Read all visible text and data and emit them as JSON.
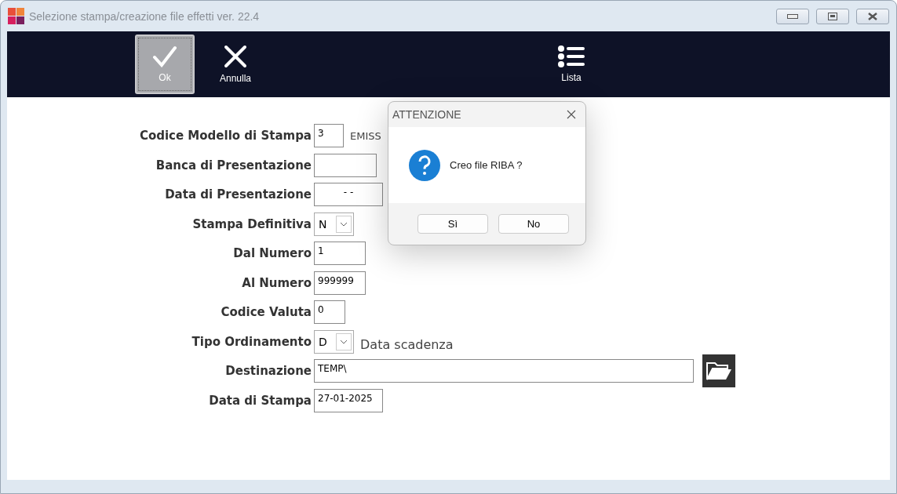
{
  "window": {
    "title": "Selezione stampa/creazione file effetti  ver. 22.4"
  },
  "toolbar": [
    {
      "label": "Ok",
      "focused": true
    },
    {
      "label": "Annulla",
      "focused": false
    },
    {
      "label": "Lista",
      "focused": false
    }
  ],
  "form": [
    {
      "label": "Codice Modello di Stampa",
      "kind": "text",
      "value": "3",
      "note": "EMISS"
    },
    {
      "label": "Banca di Presentazione",
      "kind": "text"
    },
    {
      "label": "Data di Presentazione",
      "kind": "date",
      "value": "- -"
    },
    {
      "label": "Stampa Definitiva",
      "kind": "select",
      "value": "N"
    },
    {
      "label": "Dal Numero",
      "kind": "text",
      "value": "1"
    },
    {
      "label": "Al Numero",
      "kind": "text",
      "value": "999999"
    },
    {
      "label": "Codice Valuta",
      "kind": "text",
      "value": "0"
    },
    {
      "label": "Tipo Ordinamento",
      "kind": "select",
      "value": "D",
      "note": "Data scadenza"
    },
    {
      "label": "Destinazione",
      "kind": "path",
      "value": "TEMP\\"
    },
    {
      "label": "Data di Stampa",
      "kind": "text",
      "value": "27-01-2025"
    }
  ],
  "dialog": {
    "title": "ATTENZIONE",
    "message": "Creo file RIBA ?",
    "buttons": [
      "Sì",
      "No"
    ]
  }
}
